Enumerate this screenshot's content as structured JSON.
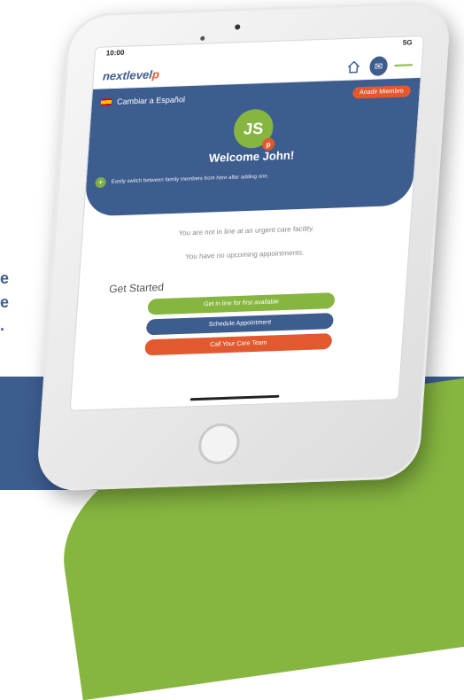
{
  "marketing": {
    "side_letters": [
      "e",
      "e",
      "."
    ]
  },
  "status_bar": {
    "time": "10:00",
    "network": "5G"
  },
  "app": {
    "logo_part1": "next",
    "logo_part2": "level",
    "logo_mark": "p"
  },
  "hero": {
    "language_toggle": "Cambiar a Español",
    "member_button": "Anadir Miembro",
    "avatar_initials": "JS",
    "avatar_badge": "p",
    "welcome": "Welcome John!",
    "hint": "Easily switch between family members from here after adding one."
  },
  "messages": {
    "urgent_care": "You are not in line at an urgent care facility.",
    "appointments": "You have no upcoming appointments."
  },
  "get_started": {
    "title": "Get Started",
    "buttons": [
      {
        "label": "Get in line for first available"
      },
      {
        "label": "Schedule Appointment"
      },
      {
        "label": "Call Your Care Team"
      }
    ]
  },
  "colors": {
    "brand_blue": "#3d5d8f",
    "brand_green": "#86b640",
    "brand_orange": "#e2592f"
  }
}
